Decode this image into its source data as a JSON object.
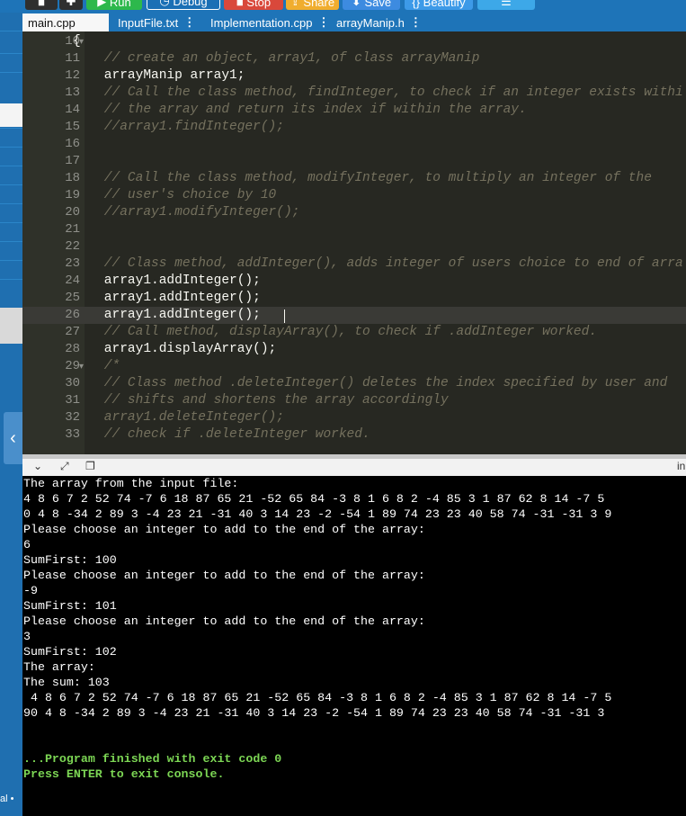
{
  "toolbar": {
    "run": "Run",
    "debug": "Debug",
    "stop": "Stop",
    "share": "Share",
    "save": "Save",
    "beautify": "Beautify"
  },
  "tabs": [
    {
      "label": "main.cpp"
    },
    {
      "label": "InputFile.txt"
    },
    {
      "label": "Implementation.cpp"
    },
    {
      "label": "arrayManip.h"
    }
  ],
  "tab_menu_glyph": "⋮",
  "editor": {
    "lines": [
      {
        "num": "10",
        "text": "{",
        "type": "code",
        "fold": true
      },
      {
        "num": "11",
        "text": "    // create an object, array1, of class arrayManip",
        "type": "cmt"
      },
      {
        "num": "12",
        "text": "    arrayManip array1;",
        "type": "code"
      },
      {
        "num": "13",
        "text": "    // Call the class method, findInteger, to check if an integer exists withi",
        "type": "cmt"
      },
      {
        "num": "14",
        "text": "    // the array and return its index if within the array.",
        "type": "cmt"
      },
      {
        "num": "15",
        "text": "    //array1.findInteger();",
        "type": "cmt"
      },
      {
        "num": "16",
        "text": "",
        "type": "code"
      },
      {
        "num": "17",
        "text": "",
        "type": "code"
      },
      {
        "num": "18",
        "text": "    // Call the class method, modifyInteger, to multiply an integer of the",
        "type": "cmt"
      },
      {
        "num": "19",
        "text": "    // user's choice by 10",
        "type": "cmt"
      },
      {
        "num": "20",
        "text": "    //array1.modifyInteger();",
        "type": "cmt"
      },
      {
        "num": "21",
        "text": "",
        "type": "code"
      },
      {
        "num": "22",
        "text": "",
        "type": "code"
      },
      {
        "num": "23",
        "text": "    // Class method, addInteger(), adds integer of users choice to end of arra",
        "type": "cmt"
      },
      {
        "num": "24",
        "text": "    array1.addInteger();",
        "type": "code"
      },
      {
        "num": "25",
        "text": "    array1.addInteger();",
        "type": "code"
      },
      {
        "num": "26",
        "text": "    array1.addInteger();",
        "type": "code",
        "highlight": true
      },
      {
        "num": "27",
        "text": "    // Call method, displayArray(), to check if .addInteger worked.",
        "type": "cmt"
      },
      {
        "num": "28",
        "text": "    array1.displayArray();",
        "type": "code"
      },
      {
        "num": "29",
        "text": "    /*",
        "type": "cmt",
        "fold": true
      },
      {
        "num": "30",
        "text": "    // Class method .deleteInteger() deletes the index specified by user and",
        "type": "cmt"
      },
      {
        "num": "31",
        "text": "    // shifts and shortens the array accordingly",
        "type": "cmt"
      },
      {
        "num": "32",
        "text": "    array1.deleteInteger();",
        "type": "cmt"
      },
      {
        "num": "33",
        "text": "    // check if .deleteInteger worked.",
        "type": "cmt"
      }
    ]
  },
  "console_header": {
    "right_label": "in"
  },
  "console": {
    "lines": [
      {
        "text": "The array from the input file:",
        "color": "white"
      },
      {
        "text": "4 8 6 7 2 52 74 -7 6 18 87 65 21 -52 65 84 -3 8 1 6 8 2 -4 85 3 1 87 62 8 14 -7 5",
        "color": "white"
      },
      {
        "text": "0 4 8 -34 2 89 3 -4 23 21 -31 40 3 14 23 -2 -54 1 89 74 23 23 40 58 74 -31 -31 3 9",
        "color": "white"
      },
      {
        "text": "Please choose an integer to add to the end of the array:",
        "color": "white"
      },
      {
        "text": "6",
        "color": "white"
      },
      {
        "text": "SumFirst: 100",
        "color": "white"
      },
      {
        "text": "Please choose an integer to add to the end of the array:",
        "color": "white"
      },
      {
        "text": "-9",
        "color": "white"
      },
      {
        "text": "SumFirst: 101",
        "color": "white"
      },
      {
        "text": "Please choose an integer to add to the end of the array:",
        "color": "white"
      },
      {
        "text": "3",
        "color": "white"
      },
      {
        "text": "SumFirst: 102",
        "color": "white"
      },
      {
        "text": "The array:",
        "color": "white"
      },
      {
        "text": "The sum: 103",
        "color": "white"
      },
      {
        "text": " 4 8 6 7 2 52 74 -7 6 18 87 65 21 -52 65 84 -3 8 1 6 8 2 -4 85 3 1 87 62 8 14 -7 5",
        "color": "white"
      },
      {
        "text": "90 4 8 -34 2 89 3 -4 23 21 -31 40 3 14 23 -2 -54 1 89 74 23 23 40 58 74 -31 -31 3",
        "color": "white"
      },
      {
        "text": "",
        "color": "white"
      },
      {
        "text": "",
        "color": "white"
      },
      {
        "text": "...Program finished with exit code 0",
        "color": "green"
      },
      {
        "text": "Press ENTER to exit console.",
        "color": "green"
      }
    ]
  },
  "sidebar": {
    "footer_label": "al •"
  },
  "colors": {
    "toolbar_bg": "#1e74b8",
    "run_green": "#2db84c",
    "debug_blue": "#1a6fb5",
    "stop_red": "#d9483b",
    "share_orange": "#f0ad2e",
    "save_blue": "#3d8be0",
    "editor_bg": "#272822",
    "comment": "#75715e",
    "console_green": "#7cd654"
  }
}
